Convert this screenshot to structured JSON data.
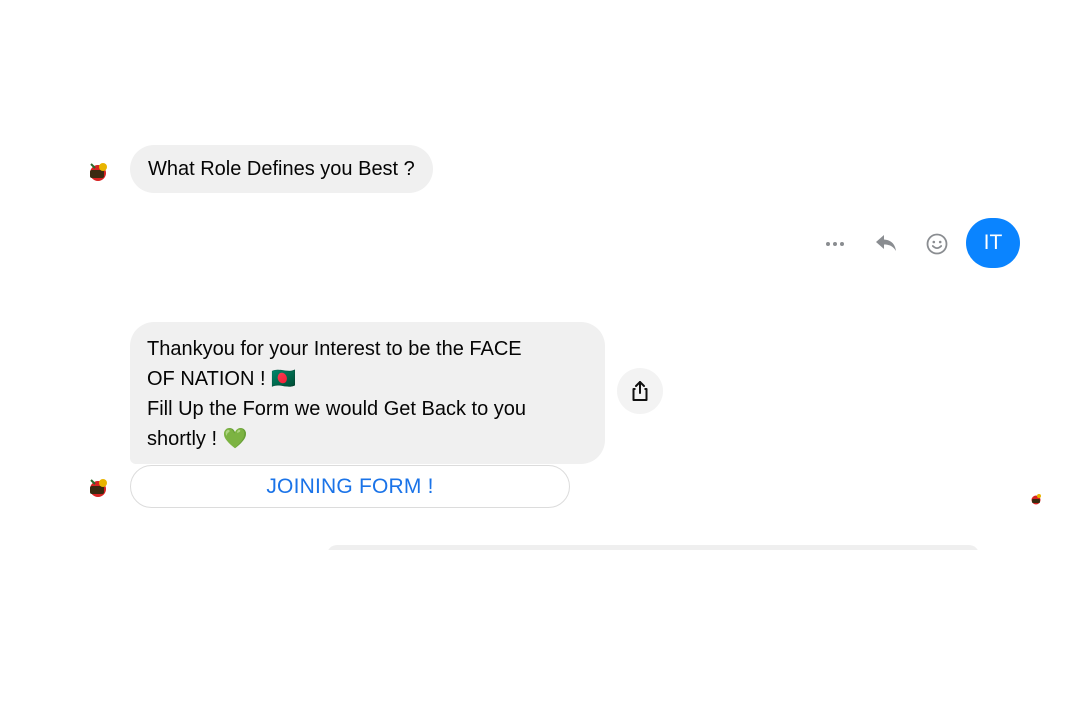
{
  "chat": {
    "question": "What Role Defines you Best ?",
    "message_lines": [
      "Thankyou for your Interest to be the FACE",
      "OF NATION ! 🇧🇩",
      "Fill Up the Form we would Get Back to you",
      "shortly ! 💚"
    ],
    "button_label": "JOINING FORM !",
    "user_reply": "IT"
  },
  "icons": {
    "more": "more-options-icon",
    "reply": "reply-icon",
    "react": "smiley-icon",
    "share": "share-icon",
    "page_avatar": "page-avatar-icon",
    "seen": "seen-avatar-icon"
  },
  "colors": {
    "accent": "#0a84ff",
    "link": "#1a73e8",
    "bubble": "#f0f0f0"
  }
}
